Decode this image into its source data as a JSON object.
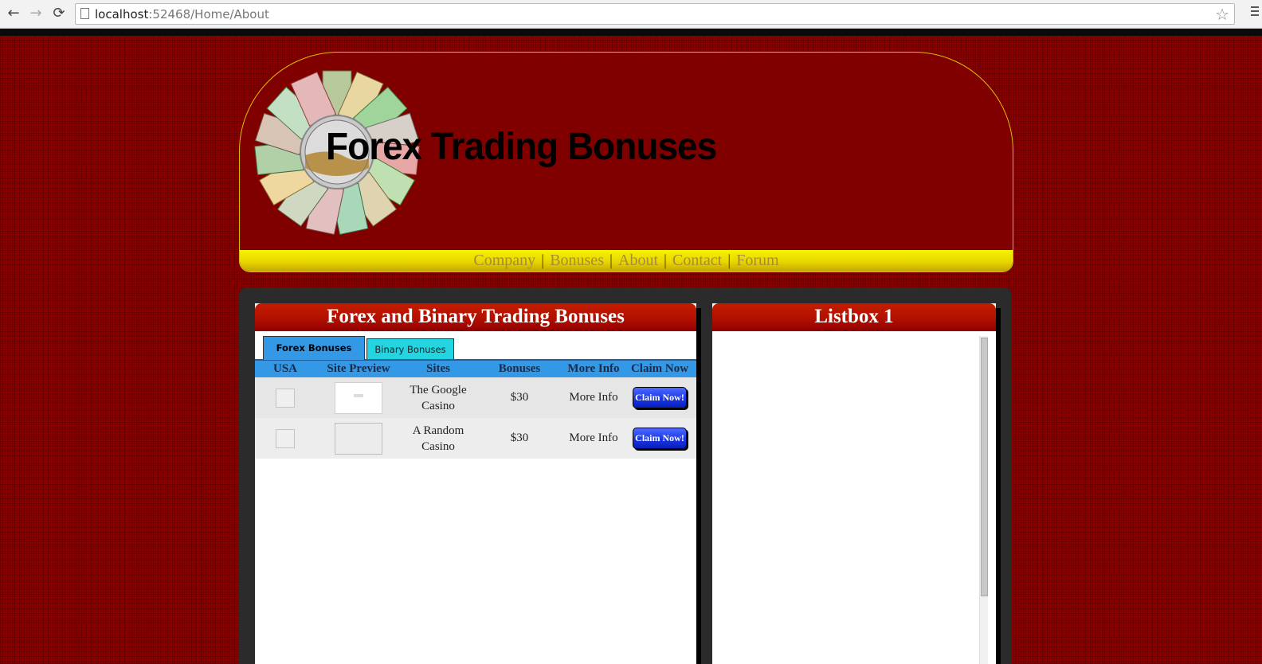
{
  "browser": {
    "url_host": "localhost",
    "url_path": ":52468/Home/About",
    "back": "←",
    "forward": "→",
    "reload": "⟳",
    "star": "☆"
  },
  "header": {
    "title": "Forex Trading Bonuses"
  },
  "nav": {
    "items": [
      {
        "label": "Company"
      },
      {
        "label": "Bonuses"
      },
      {
        "label": "About"
      },
      {
        "label": "Contact"
      },
      {
        "label": "Forum"
      }
    ],
    "separator": "|"
  },
  "left_panel": {
    "title": "Forex and Binary Trading Bonuses",
    "tabs": [
      {
        "label": "Forex Bonuses",
        "active": true
      },
      {
        "label": "Binary Bonuses",
        "active": false
      }
    ],
    "columns": [
      "USA",
      "Site Preview",
      "Sites",
      "Bonuses",
      "More Info",
      "Claim Now"
    ],
    "rows": [
      {
        "site_line1": "The Google",
        "site_line2": "Casino",
        "bonus": "$30",
        "more_info": "More Info",
        "claim": "Claim Now!"
      },
      {
        "site_line1": "A Random",
        "site_line2": "Casino",
        "bonus": "$30",
        "more_info": "More Info",
        "claim": "Claim Now!"
      }
    ]
  },
  "right_panel": {
    "title": "Listbox 1"
  },
  "colors": {
    "page_bg": "#8d0000",
    "header_bg": "#800000",
    "nav_yellow": "#e8d600",
    "panel_header_red": "#b00e00",
    "tab_blue": "#3399e6",
    "tab_cyan": "#22d5e0",
    "claim_blue": "#1a35e6"
  }
}
